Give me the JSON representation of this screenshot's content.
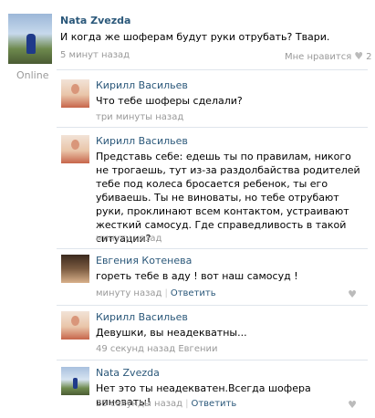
{
  "post": {
    "author": "Nata Zvezda",
    "text": "И когда же шоферам будут руки отрубать? Твари.",
    "time": "5 минут назад",
    "like_label": "Мне нравится",
    "like_count": "2",
    "online": "Online"
  },
  "replies": [
    {
      "author": "Кирилл Васильев",
      "text": "Что тебе шоферы сделали?",
      "time": "три минуты назад"
    },
    {
      "author": "Кирилл Васильев",
      "text": "Представь себе: едешь ты по правилам, никого не трогаешь, тут из-за раздолбайства родителей тебе под колеса бросается ребенок, ты его убиваешь. Ты не виноваты, но тебе отрубают руки, проклинают всем контактом, устраивают жесткий самосуд. Где справедливость в такой ситуации?",
      "time": "минуту назад"
    },
    {
      "author": "Евгения Котенева",
      "text": "гореть тебе в аду ! вот наш самосуд !",
      "time": "минуту назад",
      "answer": "Ответить"
    },
    {
      "author": "Кирилл Васильев",
      "text": "Девушки, вы неадекватны...",
      "time": "49 секунд назад Евгении"
    },
    {
      "author": "Nata Zvezda",
      "text": "Нет это ты неадекватен.Всегда шофера виноваты!",
      "time": "23 секунды назад",
      "answer": "Ответить"
    }
  ],
  "colors": {
    "link": "#2b587a",
    "meta": "#999999",
    "divider": "#dfe5ec"
  }
}
